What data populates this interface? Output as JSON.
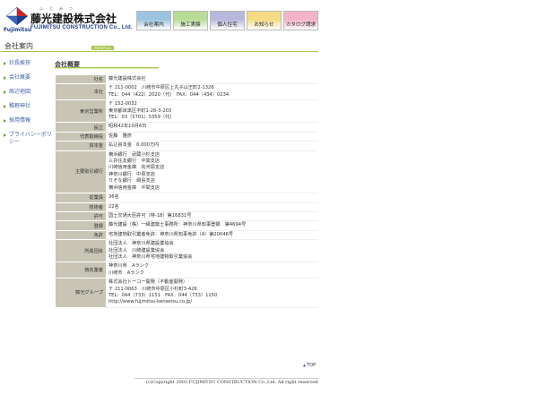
{
  "header": {
    "logo_sub": "Fujimitsu",
    "company_ruby": "ふじみつ",
    "company_name": "藤光建設株式会社",
    "company_en": "FUJIMITSU CONSTRUCTION Co., Ltd."
  },
  "nav": {
    "items": [
      {
        "label": "会社案内",
        "color": "#9cc4e0"
      },
      {
        "label": "施工実績",
        "color": "#b8dc98"
      },
      {
        "label": "個人住宅",
        "color": "#b8b8dc"
      },
      {
        "label": "お知らせ",
        "color": "#f4dc84"
      },
      {
        "label": "カタログ請求",
        "color": "#f4b4c8"
      }
    ]
  },
  "section": {
    "title": "会社案内",
    "en": "PROFILE"
  },
  "sidebar": {
    "items": [
      {
        "label": "社長挨拶"
      },
      {
        "label": "会社概要"
      },
      {
        "label": "周辺地図"
      },
      {
        "label": "稚野神社"
      },
      {
        "label": "採用情報"
      },
      {
        "label": "プライバシーポリシー"
      }
    ]
  },
  "content": {
    "title": "会社概要"
  },
  "table": {
    "rows": [
      {
        "label": "社名",
        "lines": [
          "藤光建設株式会社"
        ]
      },
      {
        "label": "本社",
        "lines": [
          "〒 211-0002　川崎市中原区上丸子山王町2-1326",
          "TEL：044（422）2020（代）　FAX：044（434）0234"
        ]
      },
      {
        "label": "東京営業所",
        "lines": [
          "〒 152-0032",
          "東京都目黒区平町1-26-3-203",
          "TEL：03（5701）5359（代）"
        ]
      },
      {
        "label": "設立",
        "lines": [
          "昭和42年10月6日"
        ]
      },
      {
        "label": "代表取締役",
        "lines": [
          "佐藤　雅彦"
        ]
      },
      {
        "label": "資本金",
        "lines": [
          "払込資本金　6,000万円"
        ]
      },
      {
        "label": "主要取引銀行",
        "lines": [
          "横浜銀行　武蔵小杉支店",
          "三井住友銀行　平間支店",
          "川崎信用金庫　向河原支店",
          "神奈川銀行　中原支店",
          "りそな銀行　綱島支店",
          "横浜信用金庫　平間支店"
        ]
      },
      {
        "label": "従業員",
        "lines": [
          "36名"
        ]
      },
      {
        "label": "技術者",
        "lines": [
          "22名"
        ]
      },
      {
        "label": "許可",
        "lines": [
          "国土交通大臣許可（特-18）第16831号"
        ]
      },
      {
        "label": "登録",
        "lines": [
          "藤光建設（株）一級建築士事務所：神奈川県知事登録　第4694号"
        ]
      },
      {
        "label": "免許",
        "lines": [
          "宅地建物取引業者免許：神奈川県知事免許（4）第20046号"
        ]
      },
      {
        "label": "所属団体",
        "lines": [
          "社団法人　神奈川県建設業協会",
          "社団法人　川崎建設業協会",
          "社団法人　神奈川県宅地建物取引業協会"
        ]
      },
      {
        "label": "格名業者",
        "lines": [
          "神奈川県　Aランク",
          "川崎市　Aランク"
        ]
      },
      {
        "label": "藤光グループ",
        "lines": [
          "株式会社トーコー開発（不動産開発）",
          "〒 211-0063　川崎市中原区小杉町3-426",
          "TEL：044（733）1151　FAX：044（733）1150",
          "http://www.fujimitsu-kensetsu.co.jp/"
        ]
      }
    ]
  },
  "footer": {
    "top_link": "TOP",
    "copyright": "(c)Copyright 2003 FUJIMITSU CONSTRUCTION Co.,Ltd. All right reserved."
  },
  "colors": {
    "accent_green": "#a8c850",
    "table_header": "#c8c5b4",
    "link_blue": "#4060b0",
    "brand_blue": "#1e3c8c"
  }
}
